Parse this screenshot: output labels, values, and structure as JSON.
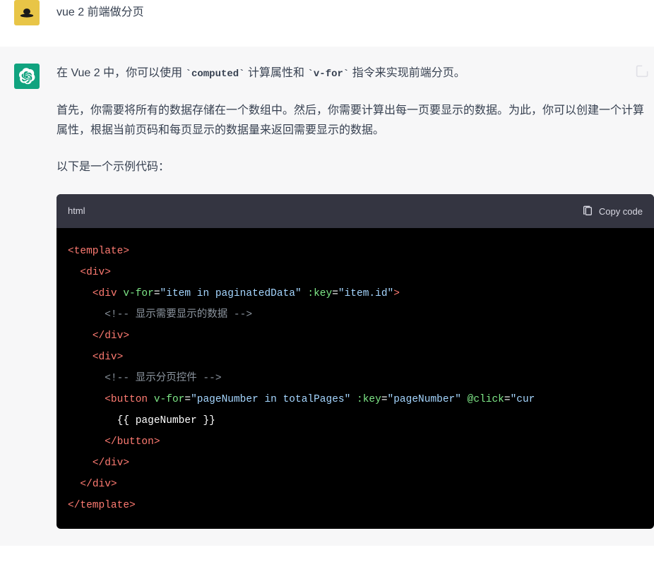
{
  "user": {
    "text": "vue 2 前端做分页"
  },
  "assistant": {
    "p1_pre": "在 Vue 2 中，你可以使用 ",
    "p1_code1": "`computed`",
    "p1_mid": " 计算属性和 ",
    "p1_code2": "`v-for`",
    "p1_post": " 指令来实现前端分页。",
    "p2": "首先，你需要将所有的数据存储在一个数组中。然后，你需要计算出每一页要显示的数据。为此，你可以创建一个计算属性，根据当前页码和每页显示的数据量来返回需要显示的数据。",
    "p3": "以下是一个示例代码："
  },
  "code": {
    "language": "html",
    "copy_label": "Copy code",
    "lines": {
      "l1_tag": "template",
      "l2_tag": "div",
      "l3_tag": "div",
      "l3_attr1": "v-for",
      "l3_val1": "\"item in paginatedData\"",
      "l3_attr2": ":key",
      "l3_val2": "\"item.id\"",
      "l4_comment": "<!-- 显示需要显示的数据 -->",
      "l5_tag": "div",
      "l6_tag": "div",
      "l7_comment": "<!-- 显示分页控件 -->",
      "l8_tag": "button",
      "l8_attr1": "v-for",
      "l8_val1": "\"pageNumber in totalPages\"",
      "l8_attr2": ":key",
      "l8_val2": "\"pageNumber\"",
      "l8_attr3": "@click",
      "l8_val3": "\"cur",
      "l9_mustache": "{{ pageNumber }}",
      "l10_tag": "button",
      "l11_tag": "div",
      "l12_tag": "div",
      "l13_tag": "template"
    }
  }
}
